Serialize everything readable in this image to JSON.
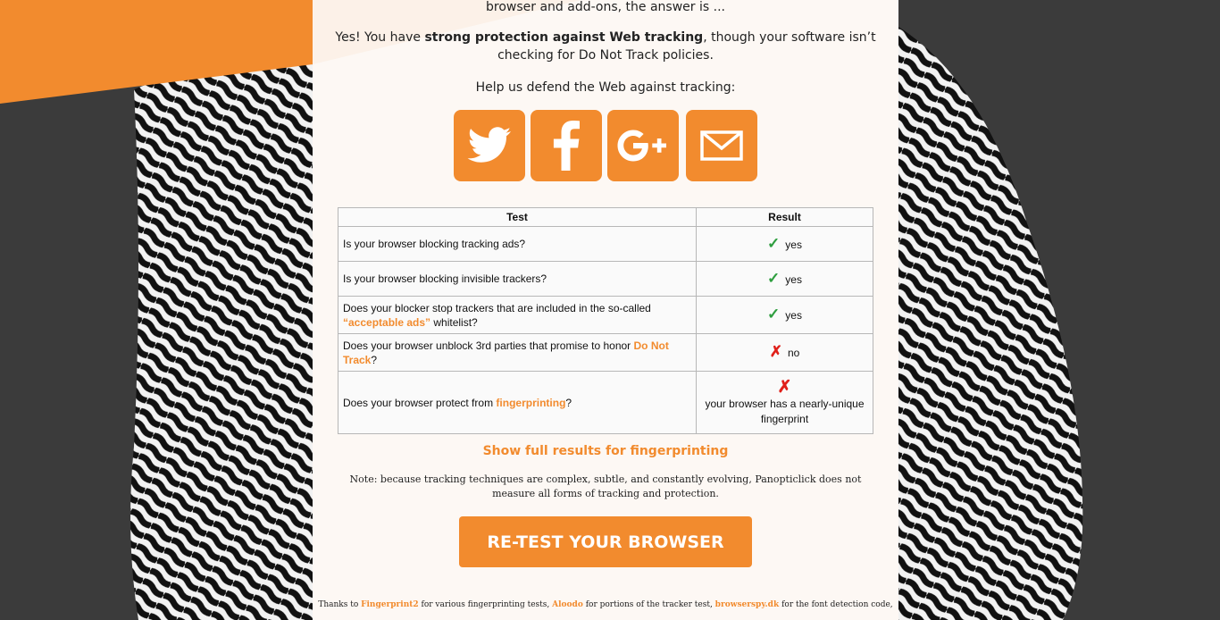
{
  "intro_tail": "browser and add-ons, the answer is ...",
  "verdict": {
    "prefix": "Yes! You have ",
    "strong": "strong protection against Web tracking",
    "suffix": ", though your software isn’t checking for Do Not Track policies."
  },
  "help_text": "Help us defend the Web against tracking:",
  "share": {
    "twitter_icon": "twitter-icon",
    "facebook_icon": "facebook-icon",
    "googleplus_icon": "google-plus-icon",
    "email_icon": "email-icon"
  },
  "table": {
    "headers": {
      "test": "Test",
      "result": "Result"
    },
    "rows": [
      {
        "question": "Is your browser blocking tracking ads?",
        "mark": "✓",
        "result": "yes"
      },
      {
        "question": "Is your browser blocking invisible trackers?",
        "mark": "✓",
        "result": "yes"
      },
      {
        "question_prefix": "Does your blocker stop trackers that are included in the so-called ",
        "link": "“acceptable ads”",
        "question_suffix": " whitelist?",
        "mark": "✓",
        "result": "yes"
      },
      {
        "question_prefix": "Does your browser unblock 3rd parties that promise to honor ",
        "link": "Do Not Track",
        "question_suffix": "?",
        "mark": "✗",
        "result": "no"
      },
      {
        "question_prefix": "Does your browser protect from ",
        "link": "fingerprinting",
        "question_suffix": "?",
        "mark": "✗",
        "result": "your browser has a nearly-unique fingerprint"
      }
    ]
  },
  "show_full": "Show full results for fingerprinting",
  "note": "Note: because tracking techniques are complex, subtle, and constantly evolving, Panopticlick does not measure all forms of tracking and protection.",
  "retest_label": "RE-TEST YOUR BROWSER",
  "thanks": {
    "t1": "Thanks to ",
    "l1": "Fingerprint2",
    "t2": " for various fingerprinting tests, ",
    "l2": "Aloodo",
    "t3": " for portions of the tracker test, ",
    "l3": "browserspy.dk",
    "t4": " for the font detection code,"
  },
  "colors": {
    "accent": "#f28b2e",
    "check": "#2e9e3f",
    "cross": "#e0201a",
    "background": "#3b3b3b"
  }
}
